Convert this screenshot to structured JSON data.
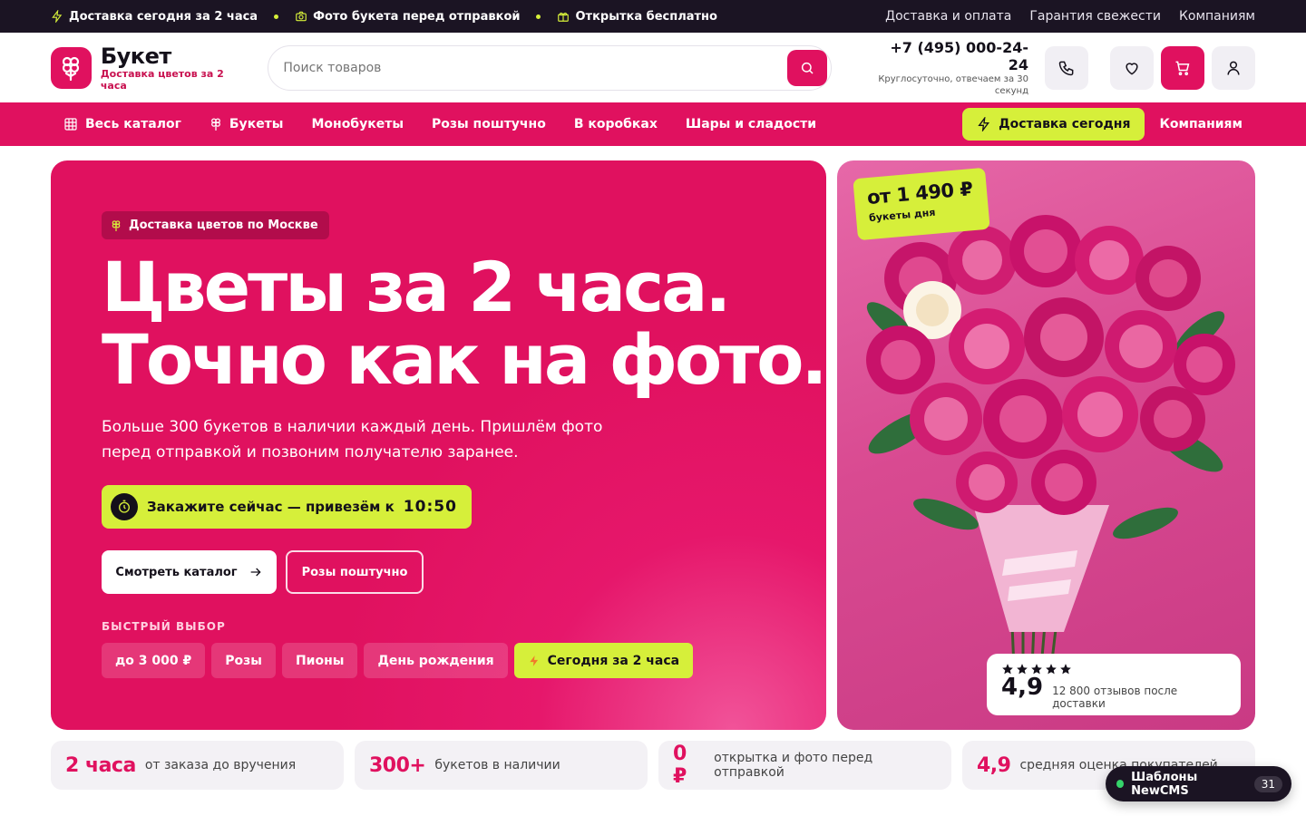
{
  "topbar": {
    "promos": [
      "Доставка сегодня за 2 часа",
      "Фото букета перед отправкой",
      "Открытка бесплатно"
    ],
    "links": [
      "Доставка и оплата",
      "Гарантия свежести",
      "Компаниям"
    ]
  },
  "header": {
    "logo_name": "Букет",
    "logo_tagline": "Доставка цветов за 2 часа",
    "search_placeholder": "Поиск товаров",
    "phone": "+7 (495) 000-24-24",
    "phone_note": "Круглосуточно, отвечаем за 30 секунд"
  },
  "nav": {
    "catalog": "Весь каталог",
    "items": [
      "Букеты",
      "Монобукеты",
      "Розы поштучно",
      "В коробках",
      "Шары и сладости"
    ],
    "today": "Доставка сегодня",
    "corporate": "Компаниям"
  },
  "hero": {
    "badge": "Доставка цветов по Москве",
    "title_line1": "Цветы за 2 часа.",
    "title_line2": "Точно как на фото.",
    "lead": "Больше 300 букетов в наличии каждый день. Пришлём фото перед отправкой и позвоним получателю заранее.",
    "timer_text": "Закажите сейчас — привезём к",
    "timer_time": "10:50",
    "btn_catalog": "Смотреть каталог",
    "btn_roses": "Розы поштучно",
    "quick_label": "БЫСТРЫЙ ВЫБОР",
    "chips": [
      "до 3 000 ₽",
      "Розы",
      "Пионы",
      "День рождения"
    ],
    "chip_hot": "Сегодня за 2 часа"
  },
  "bouquet": {
    "price": "от 1 490 ₽",
    "price_sub": "букеты дня",
    "rating": "4,9",
    "stars": 5,
    "reviews": "12 800 отзывов после доставки"
  },
  "stats": [
    {
      "big": "2 часа",
      "text": "от заказа до вручения"
    },
    {
      "big": "300+",
      "text": "букетов в наличии"
    },
    {
      "big": "0 ₽",
      "text": "открытка и фото перед отправкой"
    },
    {
      "big": "4,9",
      "text": "средняя оценка покупателей"
    }
  ],
  "cms_badge": {
    "label": "Шаблоны NewCMS",
    "count": "31"
  },
  "colors": {
    "accent": "#e0115f",
    "lime": "#d6ef3a",
    "dark": "#1b1423"
  }
}
